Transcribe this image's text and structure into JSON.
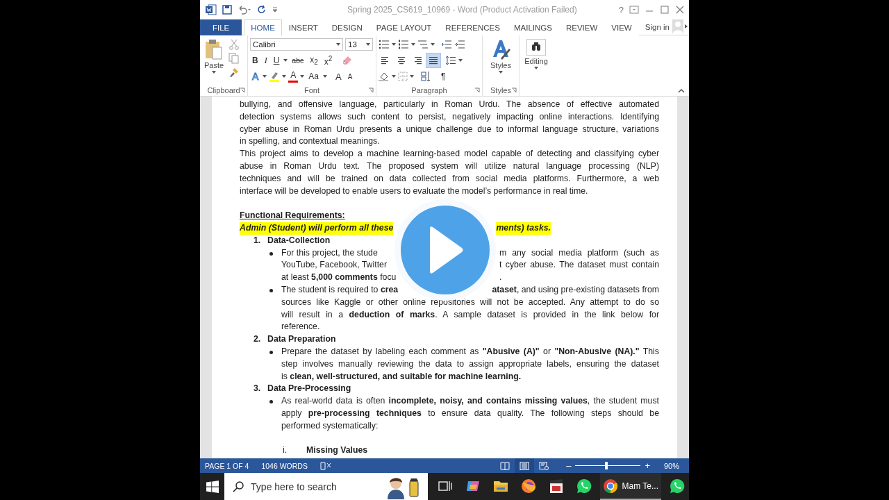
{
  "title_bar": {
    "title": "Spring 2025_CS619_10969 - Word (Product Activation Failed)",
    "help": "?"
  },
  "tabs": [
    {
      "label": "FILE",
      "kind": "file",
      "selected": false
    },
    {
      "label": "HOME",
      "kind": "tab",
      "selected": true
    },
    {
      "label": "INSERT",
      "kind": "tab",
      "selected": false
    },
    {
      "label": "DESIGN",
      "kind": "tab",
      "selected": false
    },
    {
      "label": "PAGE LAYOUT",
      "kind": "tab",
      "selected": false
    },
    {
      "label": "REFERENCES",
      "kind": "tab",
      "selected": false
    },
    {
      "label": "MAILINGS",
      "kind": "tab",
      "selected": false
    },
    {
      "label": "REVIEW",
      "kind": "tab",
      "selected": false
    },
    {
      "label": "VIEW",
      "kind": "tab",
      "selected": false
    }
  ],
  "account": {
    "label": "Sign in"
  },
  "ribbon": {
    "clipboard": {
      "paste": "Paste",
      "label": "Clipboard"
    },
    "font": {
      "name": "Calibri",
      "size": "13",
      "format_buttons": [
        "B",
        "I",
        "U",
        "abc",
        "x$_{2}$",
        "x$^{2}$"
      ],
      "effects_button": "A",
      "color_button": "A",
      "case_button": "Aa",
      "grow_button": "A",
      "shrink_button": "A",
      "label": "Font"
    },
    "paragraph": {
      "alignment": [
        {
          "selected": false
        },
        {
          "selected": false
        },
        {
          "selected": false
        },
        {
          "selected": true
        }
      ],
      "pilcrow": "¶",
      "label": "Paragraph"
    },
    "styles": {
      "button": "Styles",
      "label": "Styles"
    },
    "editing": {
      "button": "Editing"
    }
  },
  "document": {
    "blocks": [
      {
        "kind": "paragraph",
        "lines": [
          "bullying, and offensive language, particularly in Roman Urdu. The absence of effective automated",
          "detection systems allows such content to persist, negatively impacting online interactions. Identifying",
          "cyber abuse in Roman Urdu presents a unique challenge due to informal language structure, variations",
          "in spelling, and contextual meanings."
        ]
      },
      {
        "kind": "paragraph",
        "lines": [
          "This project aims to develop a machine learning-based model capable of detecting and classifying cyber",
          "abuse in Roman Urdu text. The proposed system will utilize natural language processing (NLP)",
          "techniques and will be trained on data collected from social media platforms. Furthermore, a web",
          "interface will be developed to enable users to evaluate the model’s performance in real time."
        ]
      },
      {
        "kind": "heading",
        "text": "Functional Requirements:"
      },
      {
        "kind": "highlight",
        "left": "Admin (Student) will perform all these",
        "right": "ments) tasks."
      },
      {
        "kind": "numbered",
        "number": "1.",
        "title": "Data-Collection",
        "bullets": [
          {
            "lines": [
              {
                "left": "For this project, the stude",
                "right": "m any social media platform (such as"
              },
              {
                "left": "YouTube, Facebook, Twitter",
                "right": "t cyber abuse. The dataset must contain"
              },
              {
                "left": "at least **5,000 comments** focu",
                "right": "."
              }
            ]
          },
          {
            "lines": [
              {
                "left": "The student is required to **crea**",
                "right": "**ataset**, and using pre-existing datasets from"
              },
              "sources like Kaggle or other online repositories will not be accepted. Any attempt to do so",
              "will result in a **deduction of marks**. A sample dataset is provided in the link below for",
              "reference."
            ]
          }
        ]
      },
      {
        "kind": "numbered",
        "number": "2.",
        "title": "Data Preparation",
        "bullets": [
          {
            "lines": [
              "Prepare the dataset by labeling each comment as **\"Abusive (A)\"** or **\"Non-Abusive (NA).\"** This",
              "step involves manually reviewing the data to assign appropriate labels, ensuring the dataset",
              "is **clean, well-structured, and suitable for machine learning.**"
            ]
          }
        ]
      },
      {
        "kind": "numbered",
        "number": "3.",
        "title": "Data Pre-Processing",
        "bullets": [
          {
            "lines": [
              "As real-world data is often **incomplete, noisy, and contains missing values**, the student must",
              "apply **pre-processing techniques** to ensure data quality. The following steps should be",
              "performed systematically:"
            ]
          }
        ]
      },
      {
        "kind": "subitem",
        "number": "i.",
        "title": "Missing Values"
      }
    ]
  },
  "status_bar": {
    "page": "PAGE 1 OF 4",
    "words": "1046 WORDS",
    "views": [
      {
        "selected": false
      },
      {
        "selected": true
      },
      {
        "selected": false
      }
    ],
    "zoom": {
      "minus": "–",
      "plus": "+",
      "level": 0.47,
      "percent": "90%"
    }
  },
  "taskbar": {
    "search": {
      "placeholder": "Type here to search"
    },
    "apps": [
      {
        "kind": "task-view",
        "active": false
      },
      {
        "kind": "copilot",
        "active": false
      },
      {
        "kind": "folder",
        "active": false
      },
      {
        "kind": "firefox",
        "active": false
      },
      {
        "kind": "clapper",
        "active": false
      },
      {
        "kind": "whatsapp",
        "active": false
      },
      {
        "kind": "chrome",
        "label": "Mam Te...",
        "active": true
      },
      {
        "kind": "whatsapp",
        "active": false
      }
    ]
  }
}
